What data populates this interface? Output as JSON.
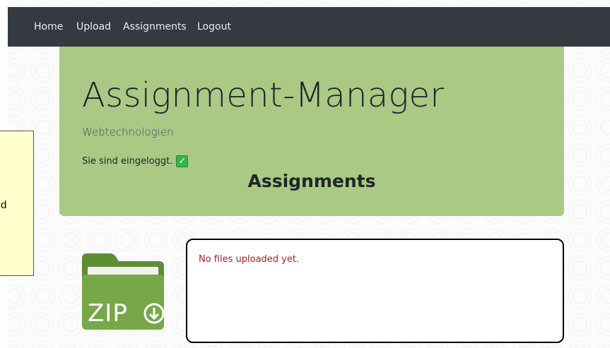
{
  "nav": {
    "items": [
      {
        "label": "Home"
      },
      {
        "label": "Upload"
      },
      {
        "label": "Assignments"
      },
      {
        "label": "Logout"
      }
    ]
  },
  "header": {
    "title": "Assignment-Manager",
    "subtitle": "Webtechnologien",
    "login_status": "Sie sind eingeloggt.",
    "login_icon": "check-icon",
    "section_title": "Assignments"
  },
  "tooltip": {
    "text": "d"
  },
  "files": {
    "empty_message": "No files uploaded yet.",
    "icon_text": "ZIP"
  },
  "colors": {
    "navbar": "#343a40",
    "jumbotron": "#a9c985",
    "zip_icon": "#6fa23f",
    "empty_message": "#9b2226"
  }
}
